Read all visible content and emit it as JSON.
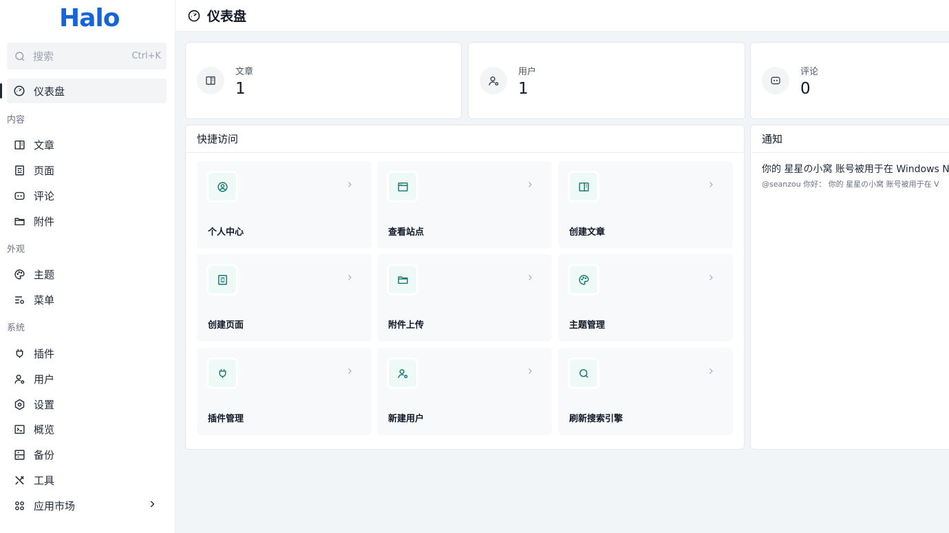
{
  "app": {
    "logo_text": "Halo",
    "brand_color": "#1565d8",
    "accent_color": "#0f766e"
  },
  "search": {
    "placeholder": "搜索",
    "shortcut": "Ctrl+K"
  },
  "sidebar": {
    "dashboard": "仪表盘",
    "groups": [
      {
        "label": "内容",
        "items": [
          "文章",
          "页面",
          "评论",
          "附件"
        ]
      },
      {
        "label": "外观",
        "items": [
          "主题",
          "菜单"
        ]
      },
      {
        "label": "系统",
        "items": [
          "插件",
          "用户",
          "设置",
          "概览",
          "备份",
          "工具",
          "应用市场"
        ]
      }
    ]
  },
  "header": {
    "title": "仪表盘",
    "icon": "dashboard-icon"
  },
  "stats": [
    {
      "label": "文章",
      "value": "1",
      "icon": "post-icon"
    },
    {
      "label": "用户",
      "value": "1",
      "icon": "user-gear-icon"
    },
    {
      "label": "评论",
      "value": "0",
      "icon": "comment-icon"
    }
  ],
  "quick_access": {
    "title": "快捷访问",
    "items": [
      {
        "label": "个人中心",
        "icon": "user-circle-icon"
      },
      {
        "label": "查看站点",
        "icon": "browser-icon"
      },
      {
        "label": "创建文章",
        "icon": "post-icon"
      },
      {
        "label": "创建页面",
        "icon": "page-icon"
      },
      {
        "label": "附件上传",
        "icon": "folder-icon"
      },
      {
        "label": "主题管理",
        "icon": "palette-icon"
      },
      {
        "label": "插件管理",
        "icon": "plug-icon"
      },
      {
        "label": "新建用户",
        "icon": "user-gear-icon"
      },
      {
        "label": "刷新搜索引擎",
        "icon": "search-icon"
      }
    ]
  },
  "notifications": {
    "title": "通知",
    "items": [
      {
        "title": "你的 星星の小窝 账号被用于在 Windows N",
        "summary": "@seanzou 你好： 你的 星星の小窝 账号被用于在 V"
      }
    ]
  }
}
